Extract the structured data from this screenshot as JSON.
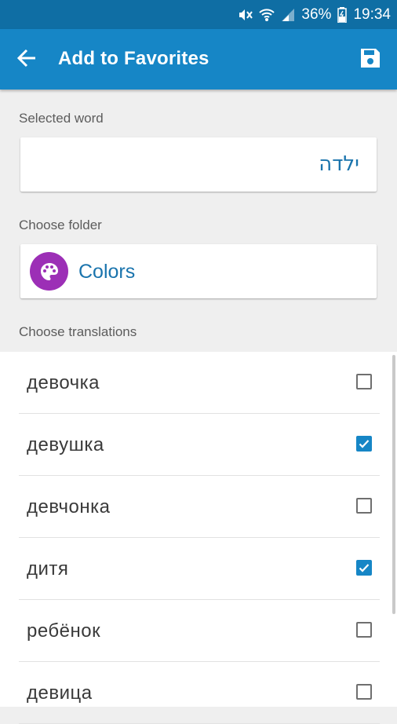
{
  "status_bar": {
    "battery": "36%",
    "time": "19:34",
    "icons": [
      "mute-icon",
      "wifi-icon",
      "signal-icon",
      "battery-icon"
    ]
  },
  "app_bar": {
    "title": "Add to Favorites",
    "back_icon": "arrow-back-icon",
    "save_icon": "save-icon"
  },
  "selected_word": {
    "label": "Selected word",
    "value": "ילדה"
  },
  "folder": {
    "label": "Choose folder",
    "name": "Colors",
    "icon": "palette-icon",
    "icon_color": "#9c2fb6"
  },
  "translations": {
    "label": "Choose translations",
    "items": [
      {
        "text": "девочка",
        "checked": false
      },
      {
        "text": "девушка",
        "checked": true
      },
      {
        "text": "девчонка",
        "checked": false
      },
      {
        "text": "дитя",
        "checked": true
      },
      {
        "text": "ребёнок",
        "checked": false
      },
      {
        "text": "девица",
        "checked": false
      }
    ]
  },
  "colors": {
    "primary": "#1686c6",
    "primary_dark": "#0f6ea4",
    "accent_text": "#1a74ad"
  }
}
